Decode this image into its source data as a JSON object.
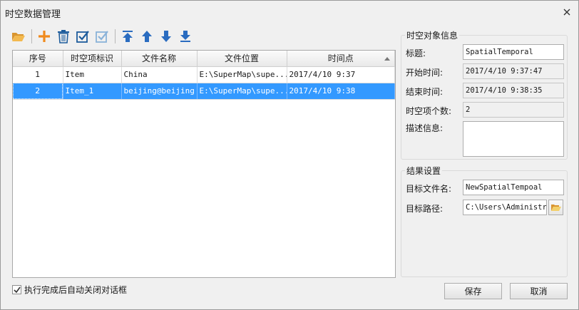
{
  "window": {
    "title": "时空数据管理"
  },
  "toolbar": {
    "buttons": [
      {
        "icon": "open-folder-icon",
        "color": "#e8a84a"
      },
      {
        "icon": "plus-icon",
        "color": "#f08a1c"
      },
      {
        "icon": "trash-icon",
        "color": "#1d5c9c"
      },
      {
        "icon": "select-all-icon",
        "color": "#1d5c9c"
      },
      {
        "icon": "invert-select-icon",
        "color": "#8ab3d9"
      },
      {
        "icon": "move-top-icon",
        "color": "#2a6cc0"
      },
      {
        "icon": "move-up-icon",
        "color": "#2a6cc0"
      },
      {
        "icon": "move-down-icon",
        "color": "#2a6cc0"
      },
      {
        "icon": "move-bottom-icon",
        "color": "#2a6cc0"
      }
    ]
  },
  "table": {
    "columns": [
      "序号",
      "时空项标识",
      "文件名称",
      "文件位置",
      "时间点"
    ],
    "rows": [
      {
        "index": "1",
        "id": "Item",
        "name": "China",
        "location": "E:\\SuperMap\\supe...",
        "time": "2017/4/10 9:37",
        "selected": false
      },
      {
        "index": "2",
        "id": "Item_1",
        "name": "beijing@beijing",
        "location": "E:\\SuperMap\\supe...",
        "time": "2017/4/10 9:38",
        "selected": true
      }
    ]
  },
  "info_group": {
    "title": "时空对象信息",
    "title_label": "标题:",
    "title_value": "SpatialTemporal",
    "start_label": "开始时间:",
    "start_value": "2017/4/10 9:37:47",
    "end_label": "结束时间:",
    "end_value": "2017/4/10 9:38:35",
    "count_label": "时空项个数:",
    "count_value": "2",
    "desc_label": "描述信息:",
    "desc_value": ""
  },
  "result_group": {
    "title": "结果设置",
    "target_name_label": "目标文件名:",
    "target_name_value": "NewSpatialTempoal",
    "target_path_label": "目标路径:",
    "target_path_value": "C:\\Users\\Administrs"
  },
  "auto_close": {
    "label": "执行完成后自动关闭对话框",
    "checked": true
  },
  "buttons": {
    "save": "保存",
    "cancel": "取消"
  },
  "colors": {
    "selection": "#3399ff",
    "background": "#f0f0f0"
  }
}
